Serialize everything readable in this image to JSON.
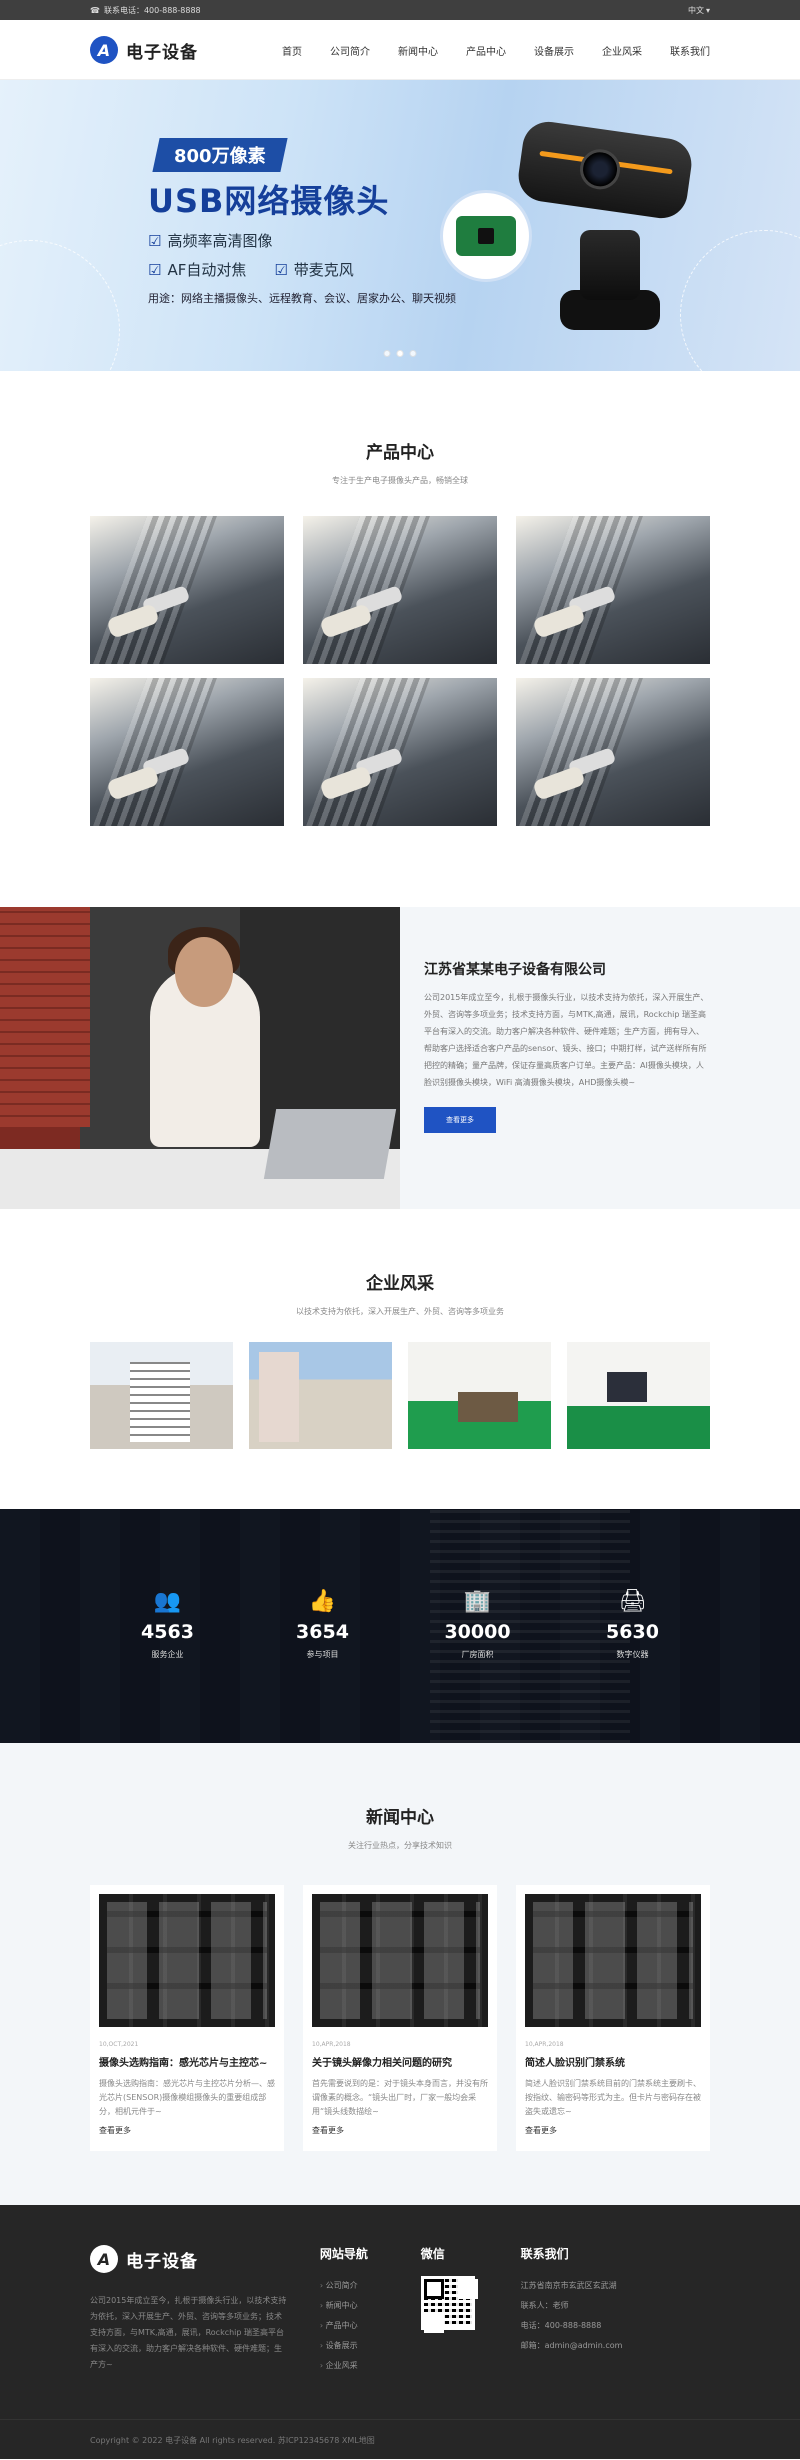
{
  "topbar": {
    "phone": "联系电话：400-888-8888",
    "lang": "中文"
  },
  "header": {
    "logo_letter": "A",
    "logo_text": "电子设备",
    "nav": [
      "首页",
      "公司简介",
      "新闻中心",
      "产品中心",
      "设备展示",
      "企业风采",
      "联系我们"
    ]
  },
  "banner": {
    "tag": "800万像素",
    "title": "USB网络摄像头",
    "features": [
      "高频率高清图像",
      "AF自动对焦",
      "带麦克风"
    ],
    "usage": "用途：网络主播摄像头、远程教育、会议、居家办公、聊天视频"
  },
  "products": {
    "title": "产品中心",
    "subtitle": "专注于生产电子摄像头产品，畅销全球"
  },
  "about": {
    "company": "江苏省某某电子设备有限公司",
    "desc": "公司2015年成立至今，扎根于摄像头行业，以技术支持为依托，深入开展生产、外贸、咨询等多项业务；技术支持方面，与MTK,高通，展讯，Rockchip 瑞圣高平台有深入的交流。助力客户解决各种软件、硬件难题；生产方面，拥有导入、帮助客户选择适合客户产品的sensor、镜头、接口；中期打样，试产送样所有所把控的精确；量产品牌，保证存量高质客户订单。主要产品：AI摄像头模块，人脸识别摄像头模块，WiFi 高清摄像头模块，AHD摄像头模~",
    "button": "查看更多"
  },
  "style": {
    "title": "企业风采",
    "subtitle": "以技术支持为依托，深入开展生产、外贸、咨询等多项业务"
  },
  "stats": [
    {
      "icon": "users-icon",
      "glyph": "👥",
      "num": "4563",
      "label": "服务企业"
    },
    {
      "icon": "thumbs-up-icon",
      "glyph": "👍",
      "num": "3654",
      "label": "参与项目"
    },
    {
      "icon": "building-icon",
      "glyph": "🏢",
      "num": "30000",
      "label": "厂房面积"
    },
    {
      "icon": "printer-icon",
      "glyph": "🖨",
      "num": "5630",
      "label": "数字仪器"
    }
  ],
  "news": {
    "title": "新闻中心",
    "subtitle": "关注行业热点，分享技术知识",
    "items": [
      {
        "date": "10,OCT,2021",
        "title": "摄像头选购指南：感光芯片与主控芯~",
        "desc": "摄像头选购指南：感光芯片与主控芯片分析—、感光芯片(SENSOR)摄像模组摄像头的重要组成部分，相机元件于~",
        "more": "查看更多"
      },
      {
        "date": "10,APR,2018",
        "title": "关于镜头解像力相关问题的研究",
        "desc": "首先需要说到的是：对于镜头本身而言，并没有所谓像素的概念。“镜头出厂时，厂家一般均会采用“镜头线数描绘~",
        "more": "查看更多"
      },
      {
        "date": "10,APR,2018",
        "title": "简述人脸识别门禁系统",
        "desc": "简述人脸识别门禁系统目前的门禁系统主要刷卡、按指纹、输密码等形式为主。但卡片与密码存在被盗失或遗忘~",
        "more": "查看更多"
      }
    ]
  },
  "footer": {
    "logo_letter": "A",
    "logo_text": "电子设备",
    "about": "公司2015年成立至今，扎根于摄像头行业，以技术支持为依托，深入开展生产、外贸、咨询等多项业务；技术支持方面，与MTK,高通，展讯，Rockchip 瑞圣高平台有深入的交流，助力客户解决各种软件、硬件难题；生产方~",
    "nav_title": "网站导航",
    "nav": [
      "公司简介",
      "新闻中心",
      "产品中心",
      "设备展示",
      "企业风采"
    ],
    "wechat_title": "微信",
    "contact_title": "联系我们",
    "contact": [
      "江苏省南京市玄武区玄武湖",
      "联系人：老师",
      "电话：400-888-8888",
      "邮箱：admin@admin.com"
    ],
    "copyright": "Copyright © 2022 电子设备 All rights reserved. 苏ICP12345678 XML地图"
  }
}
